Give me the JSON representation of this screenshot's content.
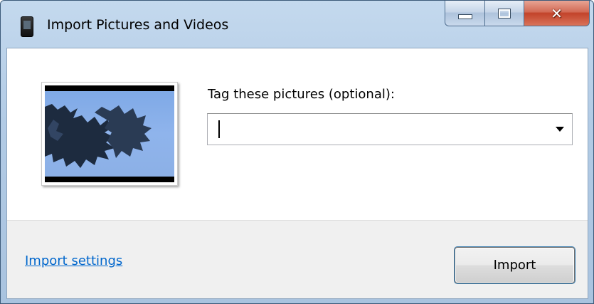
{
  "window": {
    "title": "Import Pictures and Videos",
    "app_icon": "device-phone-icon",
    "caption_buttons": {
      "minimize": "minimize-icon",
      "maximize": "maximize-icon",
      "close": "close-icon"
    }
  },
  "main": {
    "tag_label": "Tag these pictures (optional):",
    "tag_input": {
      "value": "",
      "dropdown_icon": "chevron-down-icon"
    },
    "thumbnail": {
      "content": "video-thumbnail-icon"
    }
  },
  "footer": {
    "settings_link": "Import settings",
    "import_button": "Import"
  },
  "colors": {
    "link": "#0066cc",
    "frame": "#b2cbe5",
    "close": "#c2432a"
  }
}
